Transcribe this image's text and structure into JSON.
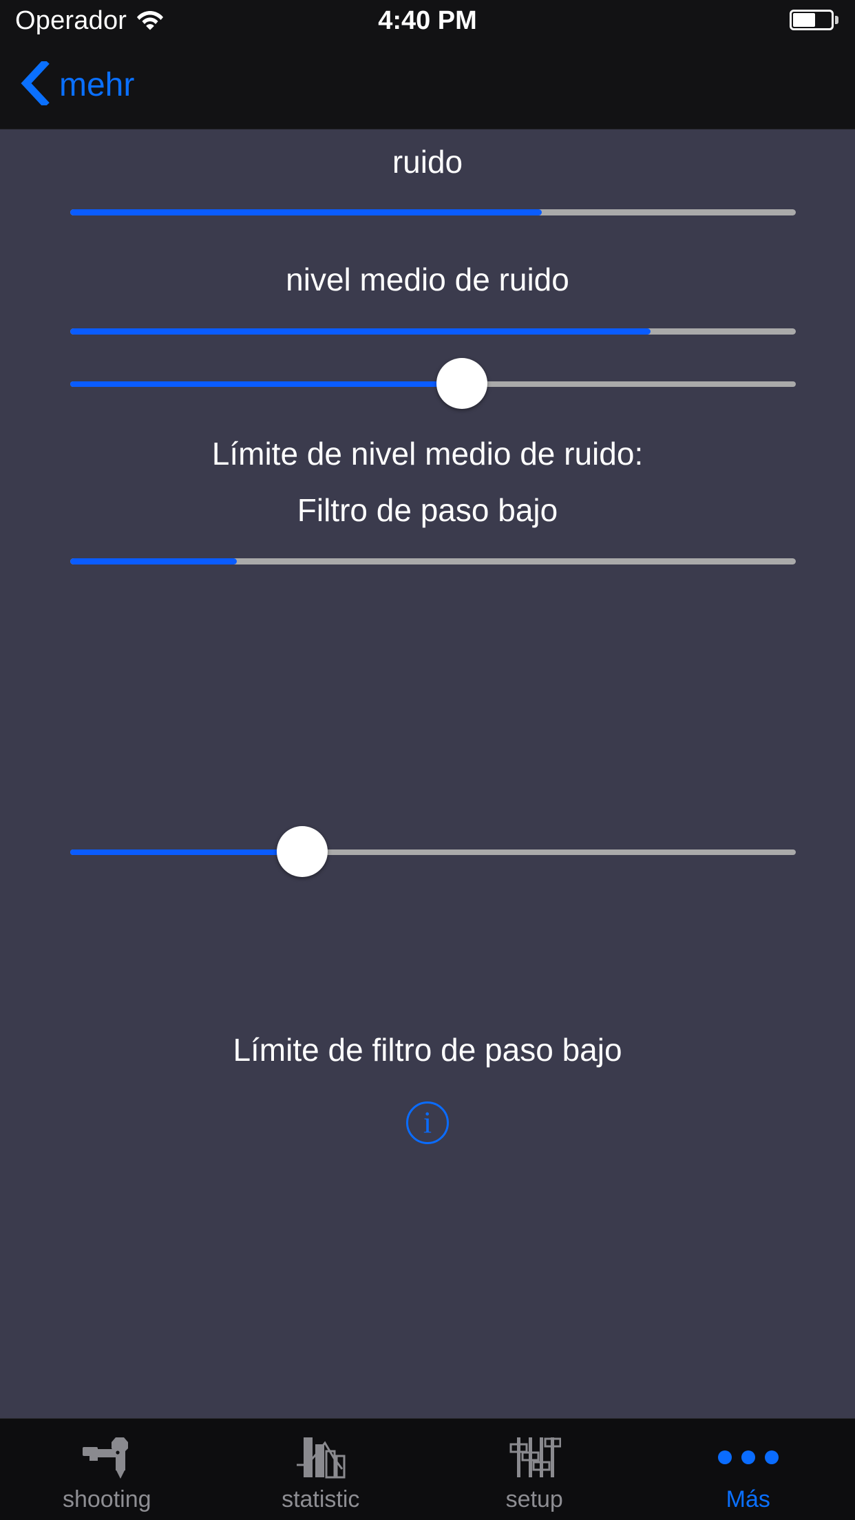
{
  "status_bar": {
    "carrier": "Operador",
    "time": "4:40 PM",
    "wifi_icon": "wifi-icon",
    "battery_icon": "battery-icon",
    "battery_level_percent": 60
  },
  "nav_bar": {
    "back_label": "mehr",
    "back_icon": "chevron-left-icon"
  },
  "colors": {
    "accent_blue": "#0a70ff",
    "slider_fill": "#0a5cff",
    "slider_track": "#aaaaaa",
    "content_background": "#3b3b4d",
    "bar_background": "#121214",
    "tab_inactive": "#8e8e93"
  },
  "controls": [
    {
      "name": "noise",
      "label": "ruido",
      "type": "progress",
      "value_percent": 65
    },
    {
      "name": "mean-noise-level",
      "label": "nivel medio de ruido",
      "type": "progress",
      "value_percent": 80
    },
    {
      "name": "mean-noise-level-limit",
      "label": "Límite de nivel medio de ruido:",
      "type": "slider",
      "value_percent": 54
    },
    {
      "name": "low-pass-filter",
      "label": "Filtro de paso bajo",
      "type": "progress",
      "value_percent": 23
    },
    {
      "name": "low-pass-filter-limit",
      "label": "Límite de filtro de paso bajo",
      "type": "slider",
      "value_percent": 32
    }
  ],
  "info_button": {
    "glyph": "i",
    "icon": "info-circle-icon"
  },
  "tab_bar": {
    "items": [
      {
        "label": "shooting",
        "icon": "rifle-icon",
        "active": false
      },
      {
        "label": "statistic",
        "icon": "bar-chart-icon",
        "active": false
      },
      {
        "label": "setup",
        "icon": "sliders-icon",
        "active": false
      },
      {
        "label": "Más",
        "icon": "ellipsis-icon",
        "active": true
      }
    ]
  }
}
